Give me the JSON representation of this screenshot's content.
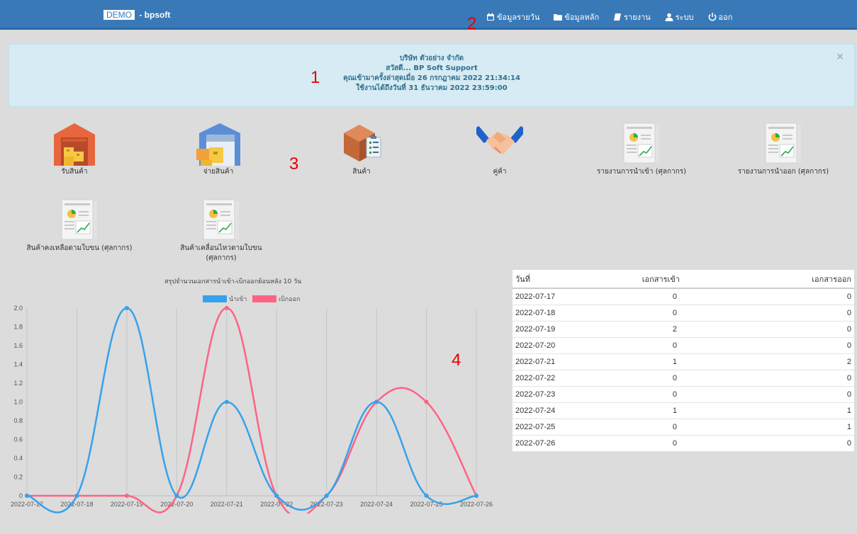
{
  "navbar": {
    "brand_badge": "DEMO",
    "brand_text": " - bpsoft",
    "items": [
      {
        "label": "ข้อมูลรายวัน",
        "icon": "calendar-icon"
      },
      {
        "label": "ข้อมูลหลัก",
        "icon": "folder-icon"
      },
      {
        "label": "รายงาน",
        "icon": "book-icon"
      },
      {
        "label": "ระบบ",
        "icon": "user-icon"
      },
      {
        "label": "ออก",
        "icon": "power-icon"
      }
    ]
  },
  "alert": {
    "line1": "บริษัท ตัวอย่าง จำกัด",
    "line2": "สวัสดี... BP Soft Support",
    "line3": "คุณเข้ามาครั้งล่าสุดเมื่อ 26 กรกฎาคม 2022 21:34:14",
    "line4": "ใช้งานได้ถึงวันที่ 31 ธันวาคม 2022 23:59:00",
    "close": "×"
  },
  "markers": [
    "1",
    "2",
    "3",
    "4"
  ],
  "tiles": [
    {
      "label": "รับสินค้า",
      "icon": "warehouse-receive-icon"
    },
    {
      "label": "จ่ายสินค้า",
      "icon": "warehouse-dispatch-icon"
    },
    {
      "label": "สินค้า",
      "icon": "product-box-icon"
    },
    {
      "label": "คู่ค้า",
      "icon": "handshake-icon"
    },
    {
      "label": "รายงานการนำเข้า (ศุลกากร)",
      "icon": "report-icon"
    },
    {
      "label": "รายงานการนำออก (ศุลกากร)",
      "icon": "report-icon"
    },
    {
      "label": "สินค้าคงเหลือตามใบขน (ศุลกากร)",
      "icon": "report-icon"
    },
    {
      "label": "สินค้าเคลื่อนไหวตามใบขน (ศุลกากร)",
      "icon": "report-icon"
    }
  ],
  "chart_data": {
    "type": "line",
    "title": "สรุปจำนวนเอกสารนำเข้า-เบิกออกย้อนหลัง 10 วัน",
    "categories": [
      "2022-07-17",
      "2022-07-18",
      "2022-07-19",
      "2022-07-20",
      "2022-07-21",
      "2022-07-22",
      "2022-07-23",
      "2022-07-24",
      "2022-07-25",
      "2022-07-26"
    ],
    "series": [
      {
        "name": "นำเข้า",
        "color": "#36a2eb",
        "values": [
          0,
          0,
          2,
          0,
          1,
          0,
          0,
          1,
          0,
          0
        ]
      },
      {
        "name": "เบิกออก",
        "color": "#ff6384",
        "values": [
          0,
          0,
          0,
          0,
          2,
          0,
          0,
          1,
          1,
          0
        ]
      }
    ],
    "yticks": [
      "0",
      "0.2",
      "0.4",
      "0.6",
      "0.8",
      "1.0",
      "1.2",
      "1.4",
      "1.6",
      "1.8",
      "2.0"
    ],
    "ylim": [
      0,
      2
    ],
    "legend": "top"
  },
  "table": {
    "headers": [
      "วันที่",
      "เอกสารเข้า",
      "เอกสารออก"
    ],
    "rows": [
      [
        "2022-07-17",
        "0",
        "0"
      ],
      [
        "2022-07-18",
        "0",
        "0"
      ],
      [
        "2022-07-19",
        "2",
        "0"
      ],
      [
        "2022-07-20",
        "0",
        "0"
      ],
      [
        "2022-07-21",
        "1",
        "2"
      ],
      [
        "2022-07-22",
        "0",
        "0"
      ],
      [
        "2022-07-23",
        "0",
        "0"
      ],
      [
        "2022-07-24",
        "1",
        "1"
      ],
      [
        "2022-07-25",
        "0",
        "1"
      ],
      [
        "2022-07-26",
        "0",
        "0"
      ]
    ]
  }
}
